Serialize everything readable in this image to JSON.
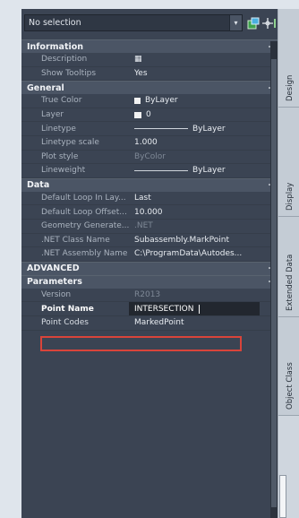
{
  "toolbar": {
    "selection": "No selection",
    "icons": [
      "dropdown-arrow-icon",
      "toggle-pickadd-icon",
      "select-objects-icon",
      "quick-select-icon"
    ]
  },
  "sections": [
    {
      "title": "Information",
      "rows": [
        {
          "name": "Description",
          "value": "▦"
        },
        {
          "name": "Show Tooltips",
          "value": "Yes"
        }
      ]
    },
    {
      "title": "General",
      "rows": [
        {
          "name": "True Color",
          "value": "ByLayer"
        },
        {
          "name": "Layer",
          "value": "0"
        },
        {
          "name": "Linetype",
          "value": "ByLayer"
        },
        {
          "name": "Linetype scale",
          "value": "1.000"
        },
        {
          "name": "Plot style",
          "value": "ByColor"
        },
        {
          "name": "Lineweight",
          "value": "ByLayer"
        }
      ]
    },
    {
      "title": "Data",
      "rows": [
        {
          "name": "Default Loop In Lay...",
          "value": "Last"
        },
        {
          "name": "Default Loop Offset...",
          "value": "10.000"
        },
        {
          "name": "Geometry Generate...",
          "value": ".NET"
        },
        {
          "name": ".NET Class Name",
          "value": "Subassembly.MarkPoint"
        },
        {
          "name": ".NET Assembly Name",
          "value": "C:\\ProgramData\\Autodes..."
        }
      ]
    },
    {
      "title": "ADVANCED",
      "rows": []
    },
    {
      "title": "Parameters",
      "rows": [
        {
          "name": "Version",
          "value": "R2013"
        },
        {
          "name": "Point Name",
          "value": "INTERSECTION"
        },
        {
          "name": "Point Codes",
          "value": "MarkedPoint"
        }
      ]
    }
  ],
  "tabs": [
    "Design",
    "Display",
    "Extended Data",
    "Object Class"
  ],
  "collapse_symbol": "−",
  "colors": {
    "panel_bg": "#3b4453",
    "header_bg": "#4b5565",
    "highlight_border": "#d9443a"
  }
}
